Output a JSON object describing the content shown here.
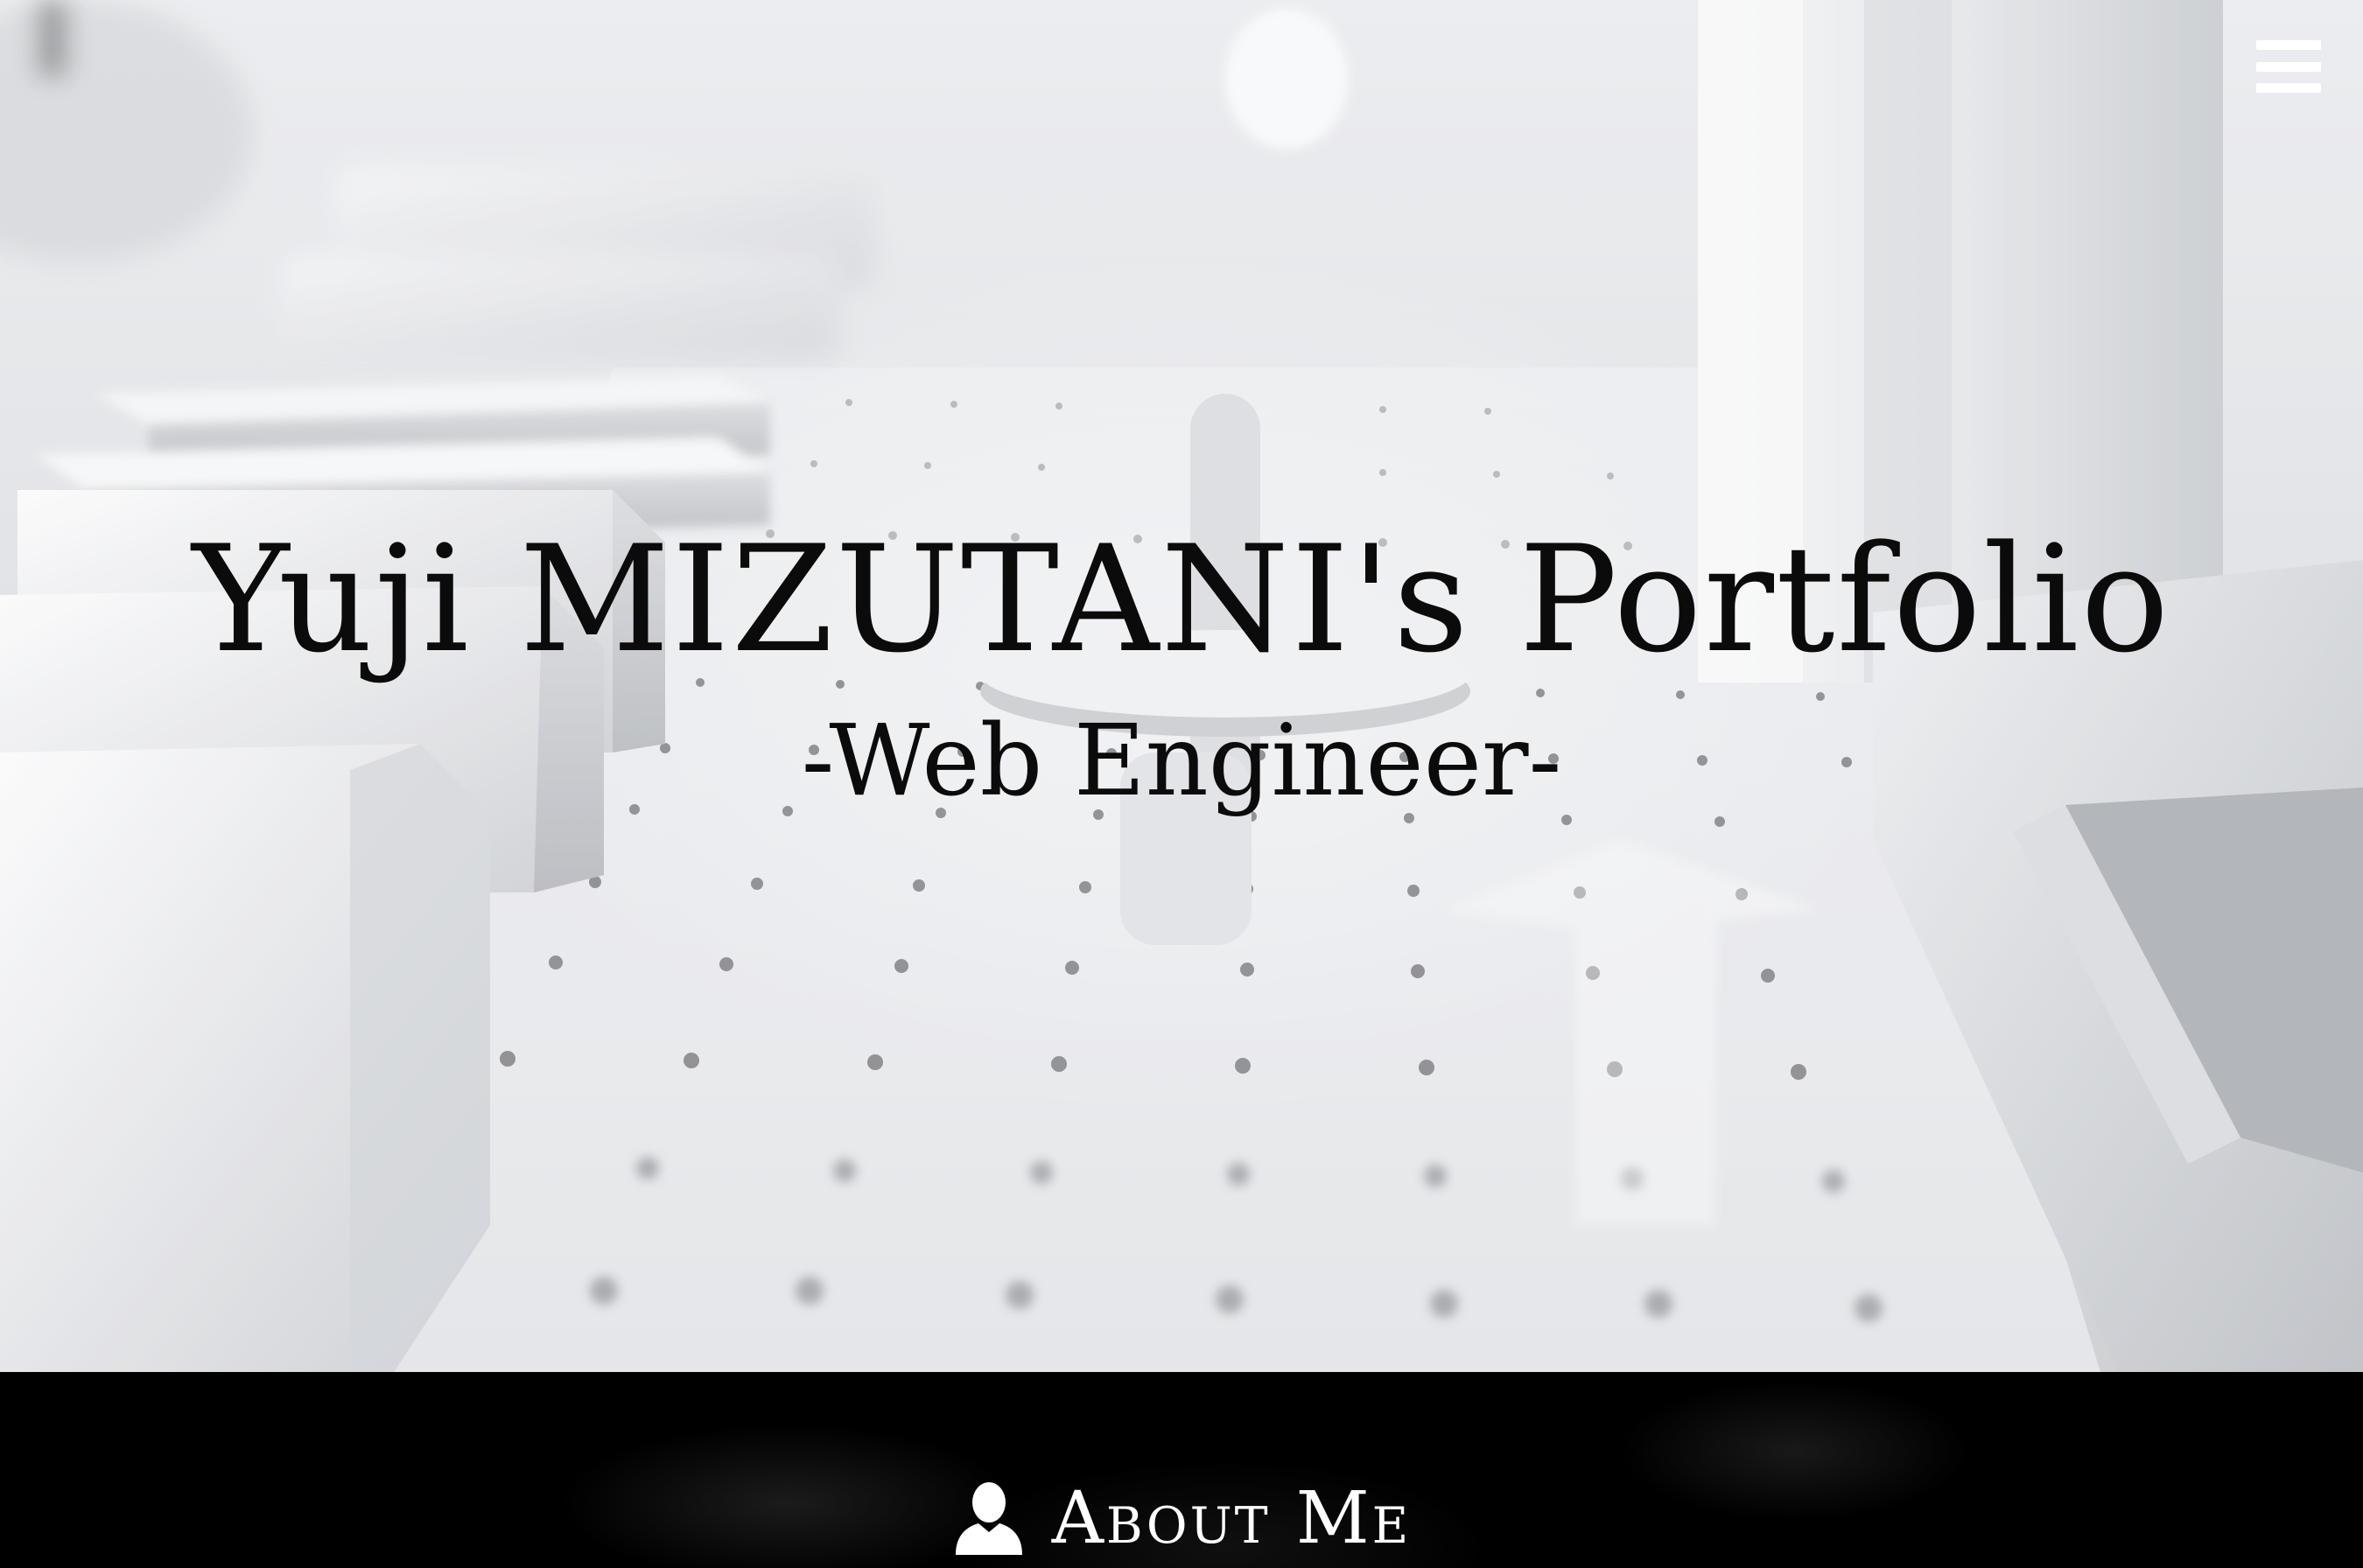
{
  "hero": {
    "title": "Yuji MIZUTANI's Portfolio",
    "subtitle": "-Web Engineer-"
  },
  "nav": {
    "menu_icon": "hamburger-menu-icon"
  },
  "about": {
    "icon": "user-icon",
    "heading": "About Me"
  },
  "colors": {
    "hero_text": "#0b0b0b",
    "section_background": "#000000",
    "section_text": "#ffffff",
    "menu_icon": "#ffffff"
  }
}
